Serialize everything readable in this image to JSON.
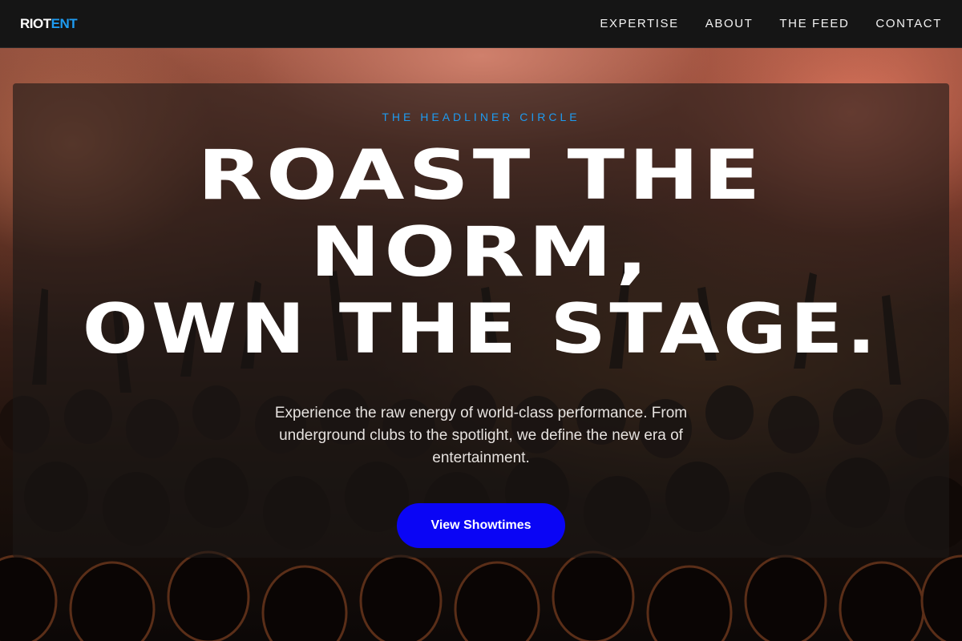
{
  "nav": {
    "logo_part1": "RIOT",
    "logo_part2": "ENT",
    "links": [
      {
        "label": "EXPERTISE"
      },
      {
        "label": "ABOUT"
      },
      {
        "label": "THE FEED"
      },
      {
        "label": "CONTACT"
      }
    ]
  },
  "hero": {
    "eyebrow": "THE HEADLINER CIRCLE",
    "headline_line1": "ROAST THE",
    "headline_line2": "NORM,",
    "headline_line3": "OWN THE STAGE.",
    "subtext": "Experience the raw energy of world-class performance. From underground clubs to the spotlight, we define the new era of entertainment.",
    "cta_label": "View Showtimes"
  },
  "colors": {
    "accent": "#1e9bf0",
    "cta": "#0a05f5",
    "nav_bg": "#151515"
  }
}
